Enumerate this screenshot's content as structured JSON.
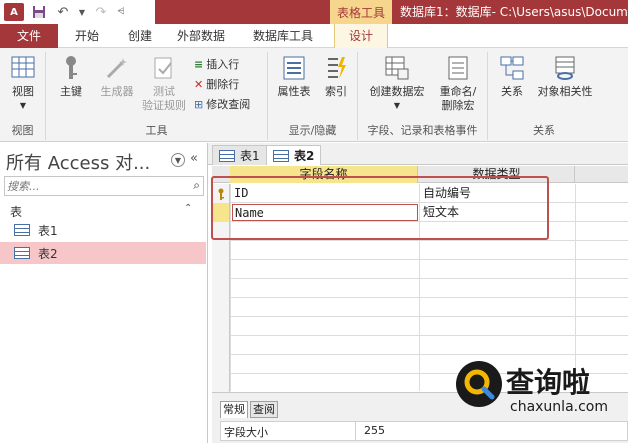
{
  "titlebar": {
    "context_tab": "表格工具",
    "window_title": "数据库1：数据库- C:\\Users\\asus\\Docume",
    "app_logo": "A",
    "qat_icons": [
      "access-logo-icon",
      "save-icon",
      "undo-icon",
      "redo-icon",
      "customize-qat-icon"
    ]
  },
  "ribbon_tabs": {
    "file": "文件",
    "home": "开始",
    "create": "创建",
    "external": "外部数据",
    "dbtools": "数据库工具",
    "design": "设计"
  },
  "ribbon": {
    "groups": {
      "view": "视图",
      "tools": "工具",
      "show_hide": "显示/隐藏",
      "events": "字段、记录和表格事件",
      "relationships": "关系"
    },
    "buttons": {
      "view": "视图",
      "primary_key": "主键",
      "builder": "生成器",
      "test_rules_1": "测试",
      "test_rules_2": "验证规则",
      "insert_rows": "插入行",
      "delete_rows": "删除行",
      "modify_lookups": "修改查阅",
      "property_sheet": "属性表",
      "indexes": "索引",
      "create_macros": "创建数据宏",
      "rename_macro_1": "重命名/",
      "rename_macro_2": "删除宏",
      "relationships": "关系",
      "object_dependencies": "对象相关性"
    }
  },
  "nav": {
    "title": "所有 Access 对...",
    "search_placeholder": "搜索...",
    "section": "表",
    "items": [
      "表1",
      "表2"
    ],
    "selected_index": 1
  },
  "doc_tabs": [
    "表1",
    "表2"
  ],
  "grid": {
    "headers": [
      "字段名称",
      "数据类型"
    ],
    "rows": [
      {
        "name": "ID",
        "type": "自动编号",
        "primary_key": true
      },
      {
        "name": "Name",
        "type": "短文本",
        "primary_key": false
      }
    ]
  },
  "properties": {
    "tabs": [
      "常规",
      "查阅"
    ],
    "label": "字段大小",
    "value": "255"
  },
  "watermark": {
    "text": "查询啦",
    "url": "chaxunla.com"
  },
  "colors": {
    "accent": "#a4373a",
    "context_tab": "#f5d68c",
    "highlight": "#c0504d"
  }
}
